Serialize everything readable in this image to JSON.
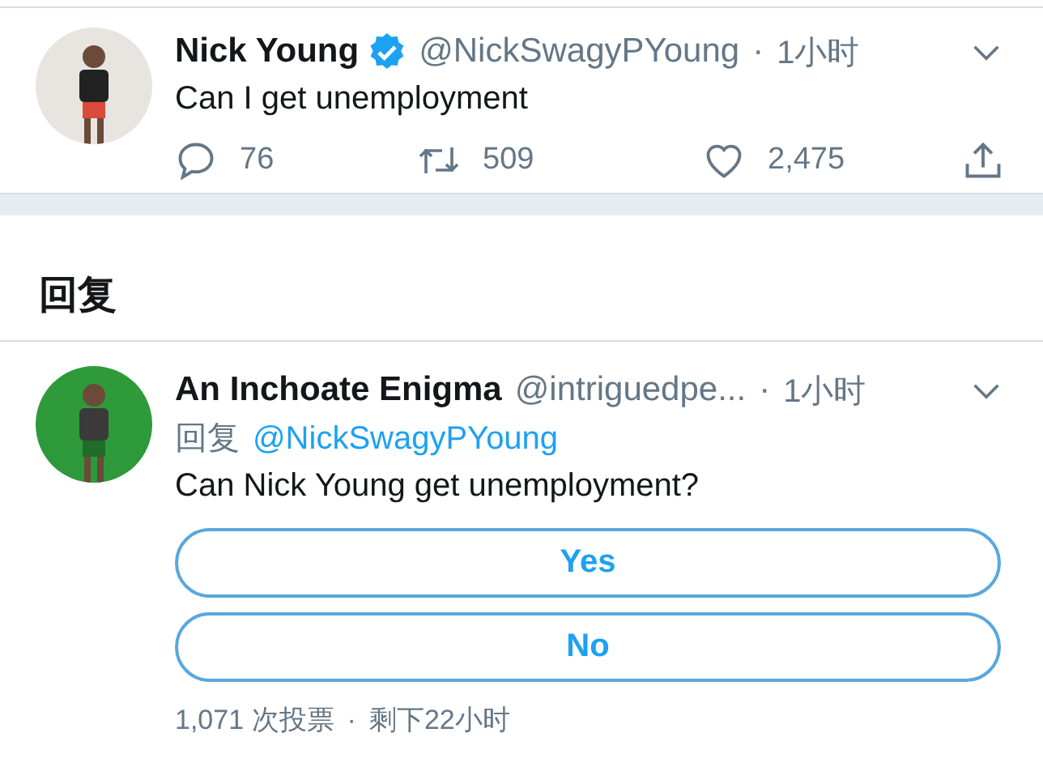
{
  "tweet": {
    "name": "Nick Young",
    "verified": true,
    "handle": "@NickSwagyPYoung",
    "separator": "·",
    "time": "1小时",
    "text": "Can I get unemployment",
    "actions": [
      {
        "kind": "reply",
        "count": "76"
      },
      {
        "kind": "retweet",
        "count": "509"
      },
      {
        "kind": "like",
        "count": "2,475"
      },
      {
        "kind": "share"
      }
    ]
  },
  "replies_header": "回复",
  "reply": {
    "name": "An Inchoate Enigma",
    "handle": "@intriguedpe...",
    "separator": "·",
    "time": "1小时",
    "reply_prefix": "回复",
    "reply_to": "@NickSwagyPYoung",
    "text": "Can Nick Young get unemployment?",
    "poll": {
      "options": [
        "Yes",
        "No"
      ],
      "votes": "1,071 次投票",
      "separator": "·",
      "remaining": "剩下22小时"
    }
  }
}
